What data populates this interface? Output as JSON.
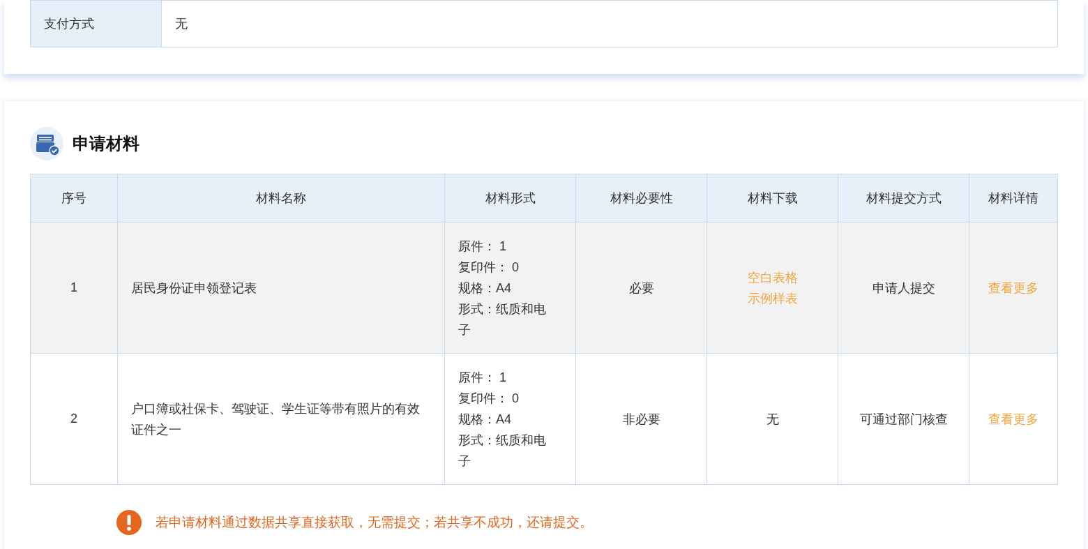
{
  "fee_table": {
    "rows": [
      {
        "label": "支付方式",
        "value": "无"
      }
    ]
  },
  "materials": {
    "title": "申请材料",
    "columns": [
      "序号",
      "材料名称",
      "材料形式",
      "材料必要性",
      "材料下载",
      "材料提交方式",
      "材料详情"
    ],
    "rows": [
      {
        "index": "1",
        "name": "居民身份证申领登记表",
        "form_lines": [
          "原件： 1",
          "复印件： 0",
          "规格：A4",
          "形式：纸质和电子"
        ],
        "necessity": "必要",
        "download": {
          "kind": "links",
          "links": [
            "空白表格",
            "示例样表"
          ]
        },
        "submit_method": "申请人提交",
        "detail_link": "查看更多",
        "highlighted": true
      },
      {
        "index": "2",
        "name": "户口簿或社保卡、驾驶证、学生证等带有照片的有效证件之一",
        "form_lines": [
          "原件： 1",
          "复印件： 0",
          "规格：A4",
          "形式：纸质和电子"
        ],
        "necessity": "非必要",
        "download": {
          "kind": "text",
          "text": "无"
        },
        "submit_method": "可通过部门核查",
        "detail_link": "查看更多",
        "highlighted": false
      }
    ],
    "notice": "若申请材料通过数据共享直接获取，无需提交；若共享不成功，还请提交。"
  }
}
